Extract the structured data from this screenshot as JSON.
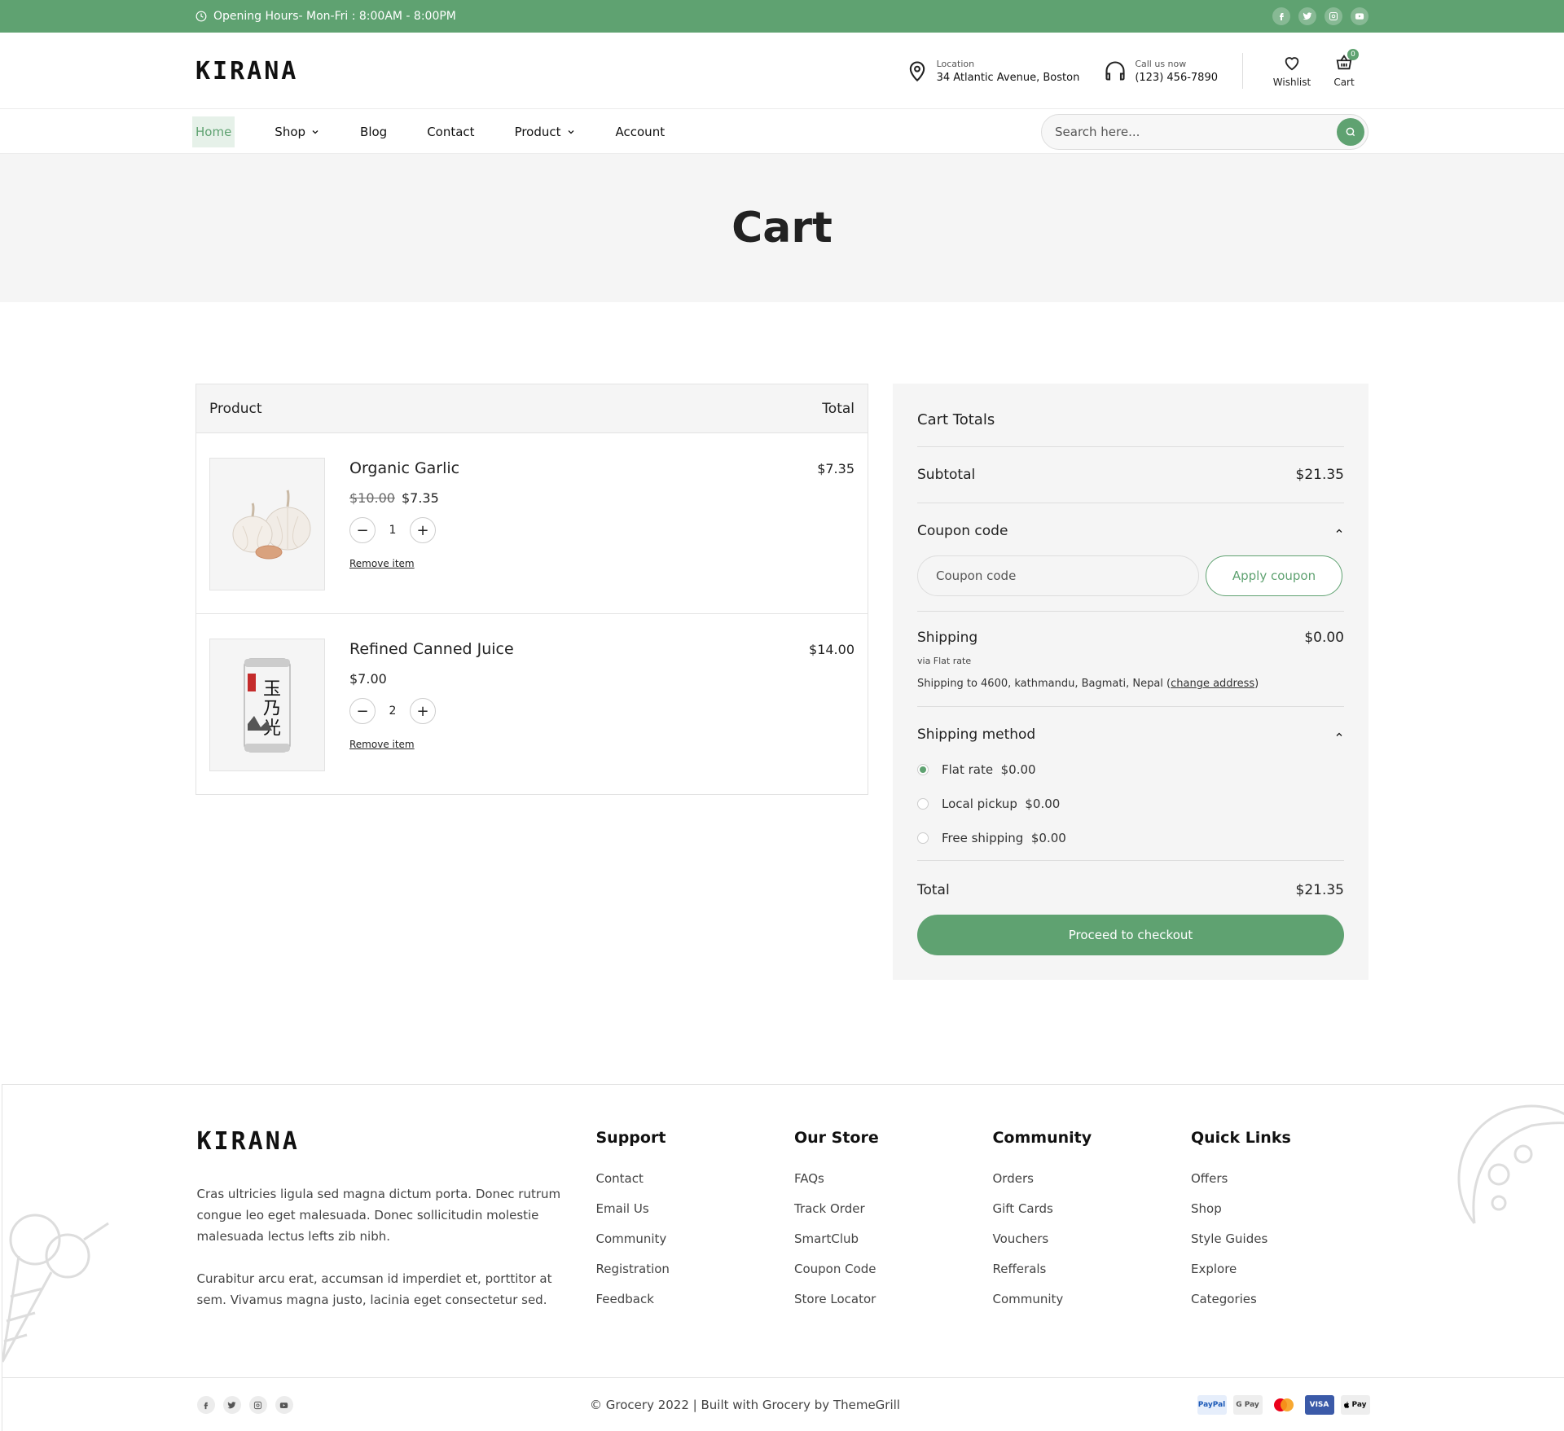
{
  "topbar": {
    "hours": "Opening Hours- Mon-Fri : 8:00AM - 8:00PM",
    "socials": [
      "facebook-icon",
      "twitter-icon",
      "instagram-icon",
      "youtube-icon"
    ]
  },
  "header": {
    "logo": "KIRANA",
    "location_label": "Location",
    "location_value": "34 Atlantic Avenue, Boston",
    "call_label": "Call us now",
    "call_value": "(123) 456-7890",
    "wishlist_label": "Wishlist",
    "cart_label": "Cart",
    "cart_count": "0"
  },
  "nav": {
    "items": [
      {
        "label": "Home",
        "active": true
      },
      {
        "label": "Shop",
        "dropdown": true
      },
      {
        "label": "Blog"
      },
      {
        "label": "Contact"
      },
      {
        "label": "Product",
        "dropdown": true
      },
      {
        "label": "Account"
      }
    ],
    "search_placeholder": "Search here..."
  },
  "page": {
    "title": "Cart"
  },
  "cart": {
    "col_product": "Product",
    "col_total": "Total",
    "items": [
      {
        "name": "Organic Garlic",
        "old_price": "$10.00",
        "price": "$7.35",
        "qty": "1",
        "total": "$7.35",
        "remove": "Remove item"
      },
      {
        "name": "Refined Canned Juice",
        "price": "$7.00",
        "qty": "2",
        "total": "$14.00",
        "remove": "Remove item"
      }
    ]
  },
  "totals": {
    "title": "Cart Totals",
    "subtotal_label": "Subtotal",
    "subtotal_value": "$21.35",
    "coupon_label": "Coupon code",
    "coupon_placeholder": "Coupon code",
    "apply_label": "Apply coupon",
    "shipping_label": "Shipping",
    "shipping_value": "$0.00",
    "shipping_via": "via Flat rate",
    "shipping_to": "Shipping to 4600, kathmandu, Bagmati, Nepal (",
    "change_address": "change address",
    "shipping_to_end": ")",
    "method_label": "Shipping method",
    "methods": [
      {
        "label": "Flat rate  $0.00",
        "selected": true
      },
      {
        "label": "Local pickup  $0.00",
        "selected": false
      },
      {
        "label": "Free shipping  $0.00",
        "selected": false
      }
    ],
    "total_label": "Total",
    "total_value": "$21.35",
    "checkout_label": "Proceed to checkout"
  },
  "footer": {
    "logo": "KIRANA",
    "para1": "Cras ultricies ligula sed magna dictum porta. Donec rutrum congue leo eget malesuada. Donec sollicitudin molestie malesuada lectus lefts zib nibh.",
    "para2": "Curabitur arcu erat, accumsan id imperdiet et, porttitor at sem. Vivamus magna justo, lacinia eget consectetur sed.",
    "columns": [
      {
        "title": "Support",
        "links": [
          "Contact",
          "Email Us",
          "Community",
          "Registration",
          "Feedback"
        ]
      },
      {
        "title": "Our Store",
        "links": [
          "FAQs",
          "Track Order",
          "SmartClub",
          "Coupon Code",
          "Store Locator"
        ]
      },
      {
        "title": "Community",
        "links": [
          "Orders",
          "Gift Cards",
          "Vouchers",
          "Refferals",
          "Community"
        ]
      },
      {
        "title": "Quick Links",
        "links": [
          "Offers",
          "Shop",
          "Style Guides",
          "Explore",
          "Categories"
        ]
      }
    ],
    "copyright": "© Grocery 2022 | Built with Grocery by ThemeGrill",
    "payments": [
      "PayPal",
      "G Pay",
      "Mastercard",
      "VISA",
      "Pay"
    ]
  },
  "colors": {
    "accent": "#5fa271",
    "panel_bg": "#f5f5f5"
  }
}
